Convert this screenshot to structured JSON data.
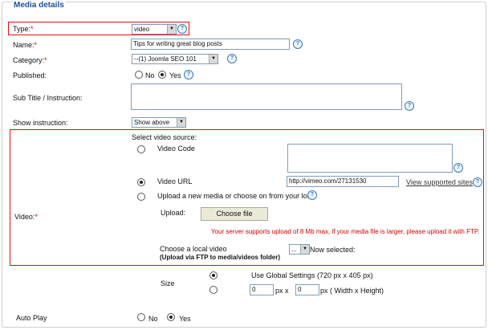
{
  "legend": "Media details",
  "type": {
    "label": "Type:",
    "req": "*",
    "value": "video"
  },
  "name": {
    "label": "Name:",
    "req": "*",
    "value": "Tips for writing great blog posts"
  },
  "category": {
    "label": "Category:",
    "req": "*",
    "value": "--(1) Joomla SEO 101"
  },
  "published": {
    "label": "Published:",
    "no": "No",
    "yes": "Yes"
  },
  "subtitle": {
    "label": "Sub Title / Instruction:"
  },
  "show_instruction": {
    "label": "Show instruction:",
    "value": "Show above"
  },
  "video": {
    "label": "Video:",
    "req": "*",
    "select_source": "Select video source:",
    "video_code": "Video Code",
    "video_url": "Video URL",
    "url_value": "http://vimeo.com/27131530",
    "supported_sites": "View supported sites",
    "upload_option": "Upload a new media or choose on from your local",
    "upload_label": "Upload:",
    "choose_file": "Choose file",
    "warning": "Your server supports upload of 8 Mb max, if your media file is larger, please upload it with FTP.",
    "choose_local": "Choose a local video",
    "upload_via_ftp": "(Upload via FTP to media/videos folder)",
    "local_select": "...",
    "now_selected": "Now selected:"
  },
  "size": {
    "label": "Size",
    "global": "Use Global Settings (720 px x 405 px)",
    "w": "0",
    "px_x": "px x",
    "h": "0",
    "px_wh": "px ( Width x Height)"
  },
  "autoplay": {
    "label": "Auto Play",
    "no": "No",
    "yes": "Yes"
  },
  "colors": {
    "legend": "#1e4f9e",
    "required": "#d40000",
    "highlight_box": "#dd1111"
  },
  "icons": {
    "help": "help-icon",
    "dropdown": "dropdown-arrow-icon"
  }
}
